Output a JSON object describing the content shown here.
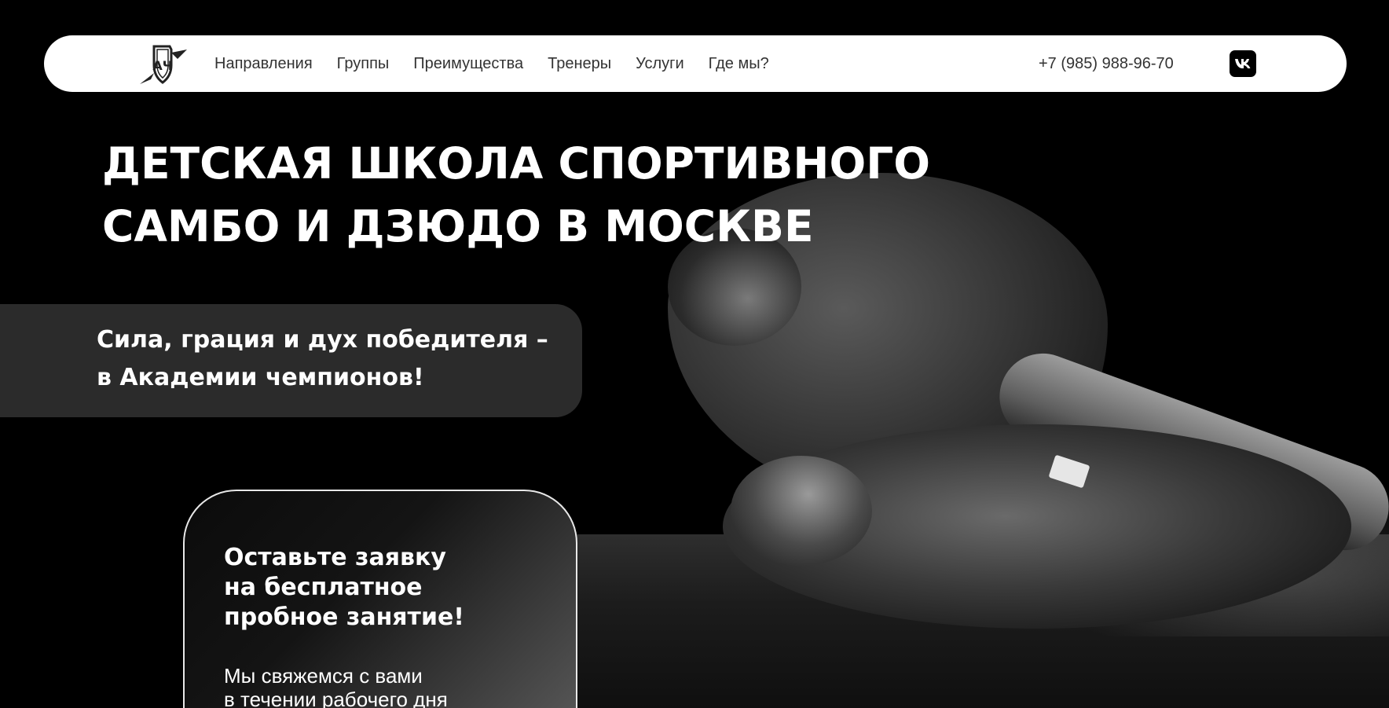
{
  "header": {
    "nav": [
      {
        "label": "Направления"
      },
      {
        "label": "Группы"
      },
      {
        "label": "Преимущества"
      },
      {
        "label": "Тренеры"
      },
      {
        "label": "Услуги"
      },
      {
        "label": "Где мы?"
      }
    ],
    "phone": "+7 (985) 988-96-70",
    "social_icon": "vk-icon",
    "logo_icon": "shield-logo-icon"
  },
  "hero": {
    "title_lines": [
      "ДЕТСКАЯ ШКОЛА СПОРТИВНОГО",
      "САМБО И ДЗЮДО В МОСКВЕ"
    ],
    "slogan_lines": [
      "Сила, грация и дух победителя –",
      "в Академии чемпионов!"
    ],
    "photo_icon": "wrestlers-photo"
  },
  "form": {
    "title_lines": [
      "Оставьте заявку",
      "на бесплатное",
      "пробное занятие!"
    ],
    "text_lines": [
      "Мы свяжемся с вами",
      "в течении рабочего дня"
    ]
  },
  "colors": {
    "background": "#000000",
    "header_bg": "#ffffff",
    "slogan_bg": "#2b2b2b",
    "text_light": "#ffffff",
    "text_dark": "#333333"
  }
}
